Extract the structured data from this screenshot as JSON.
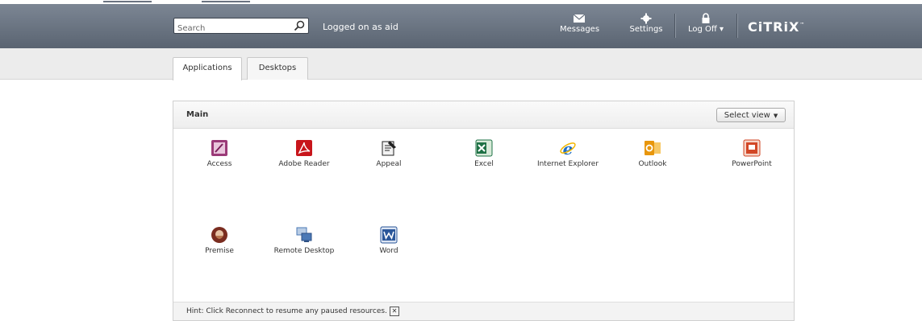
{
  "header": {
    "search": {
      "value": "Search"
    },
    "logged_in": "Logged on as aid",
    "messages": "Messages",
    "settings": "Settings",
    "log_off": "Log Off ▾",
    "brand": "CiTRiX"
  },
  "tabs": [
    {
      "label": "Applications",
      "active": true
    },
    {
      "label": "Desktops",
      "active": false
    }
  ],
  "main": {
    "title": "Main",
    "select_view": "Select view",
    "apps": [
      {
        "label": "Access",
        "icon": "access-icon",
        "color": "#8e2b6a"
      },
      {
        "label": "Adobe Reader",
        "icon": "adobe-reader-icon",
        "color": "#c8151b"
      },
      {
        "label": "Appeal",
        "icon": "appeal-icon",
        "color": "#222222"
      },
      {
        "label": "Excel",
        "icon": "excel-icon",
        "color": "#1e7145"
      },
      {
        "label": "Internet Explorer",
        "icon": "internet-explorer-icon",
        "color": "#1f6fc6"
      },
      {
        "label": "Outlook",
        "icon": "outlook-icon",
        "color": "#f0a30a"
      },
      {
        "label": "PowerPoint",
        "icon": "powerpoint-icon",
        "color": "#d24726"
      },
      {
        "label": "Premise",
        "icon": "premise-icon",
        "color": "#7a2d20"
      },
      {
        "label": "Remote Desktop",
        "icon": "remote-desktop-icon",
        "color": "#4b79b6"
      },
      {
        "label": "Word",
        "icon": "word-icon",
        "color": "#2b579a"
      }
    ]
  },
  "hint": "Hint: Click Reconnect to resume any paused resources."
}
